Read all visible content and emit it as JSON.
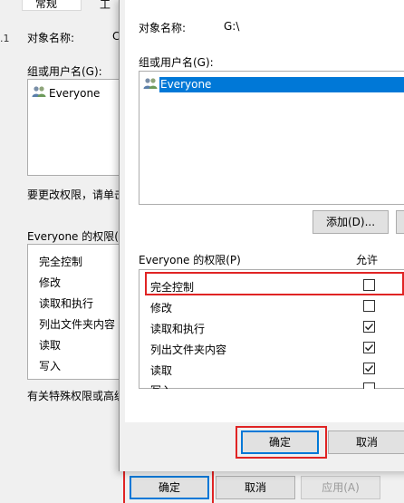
{
  "background_dialog": {
    "tab_general": "常规",
    "tab_partial": "工",
    "edge_mark": ".1",
    "object_name_label": "对象名称:",
    "object_name_value": "C",
    "group_label": "组或用户名(G):",
    "users": [
      {
        "name": "Everyone",
        "icon": "users-group-icon"
      }
    ],
    "change_hint": "要更改权限，请单击",
    "permissions_label": "Everyone 的权限(P)",
    "permissions": [
      "完全控制",
      "修改",
      "读取和执行",
      "列出文件夹内容",
      "读取",
      "写入"
    ],
    "special_hint": "有关特殊权限或高级",
    "buttons": {
      "ok": "确定",
      "cancel": "取消",
      "apply": "应用(A)"
    }
  },
  "foreground_dialog": {
    "object_name_label": "对象名称:",
    "object_name_value": "G:\\",
    "group_label": "组或用户名(G):",
    "users": [
      {
        "name": "Everyone",
        "icon": "users-group-icon",
        "selected": true
      }
    ],
    "add_button": "添加(D)...",
    "permissions_label": "Everyone 的权限(P)",
    "allow_header": "允许",
    "permissions": [
      {
        "name": "完全控制",
        "allow": false
      },
      {
        "name": "修改",
        "allow": false
      },
      {
        "name": "读取和执行",
        "allow": true
      },
      {
        "name": "列出文件夹内容",
        "allow": true
      },
      {
        "name": "读取",
        "allow": true
      },
      {
        "name": "写入",
        "allow": false
      }
    ],
    "buttons": {
      "ok": "确定",
      "cancel": "取消"
    }
  },
  "colors": {
    "selection": "#0078d7",
    "highlight_box": "#e02424",
    "dialog_bg": "#f0f0f0"
  }
}
